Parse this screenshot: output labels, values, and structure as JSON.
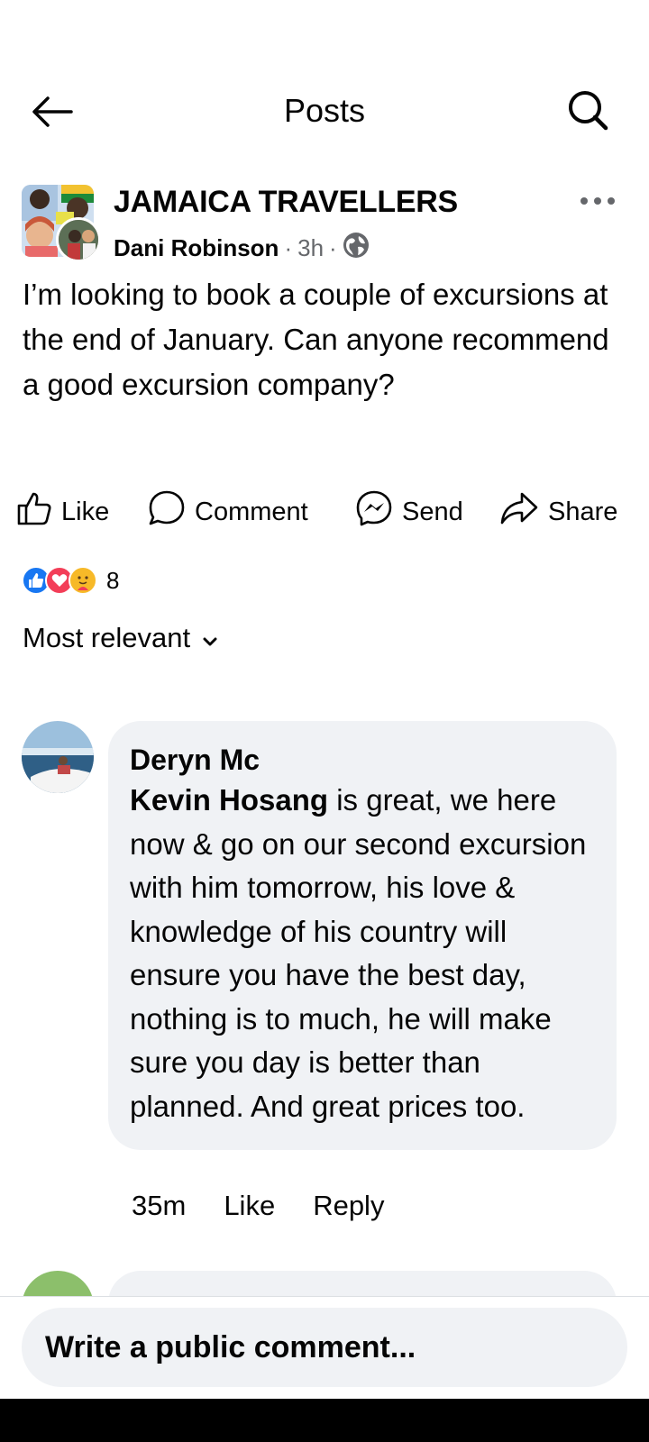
{
  "header": {
    "title": "Posts"
  },
  "post": {
    "group_name": "JAMAICA TRAVELLERS",
    "author": "Dani Robinson",
    "sep1": "·",
    "time": "3h",
    "sep2": "·",
    "text": "I’m looking to book a couple of excursions at the end of January. Can anyone recommend a good excursion company?",
    "actions": {
      "like": "Like",
      "comment": "Comment",
      "send": "Send",
      "share": "Share"
    },
    "reactions": {
      "icons": [
        "like-reaction-icon",
        "love-reaction-icon",
        "care-reaction-icon"
      ],
      "count": "8"
    },
    "sort_label": "Most relevant"
  },
  "comments": [
    {
      "author": "Deryn Mc",
      "mention": "Kevin Hosang",
      "text": " is great, we here now & go on our second excursion with him tomorrow, his love & knowledge of his country will ensure you have the best day,  nothing is to much, he will make sure you day is better than planned. And great prices too.",
      "time": "35m",
      "like": "Like",
      "reply": "Reply"
    }
  ],
  "composer": {
    "placeholder": "Write a public comment..."
  },
  "colors": {
    "bubble": "#f0f2f5",
    "like_blue": "#1877f2",
    "love_red": "#f33e58",
    "care_yellow": "#f7b928",
    "meta_gray": "#65676b"
  }
}
